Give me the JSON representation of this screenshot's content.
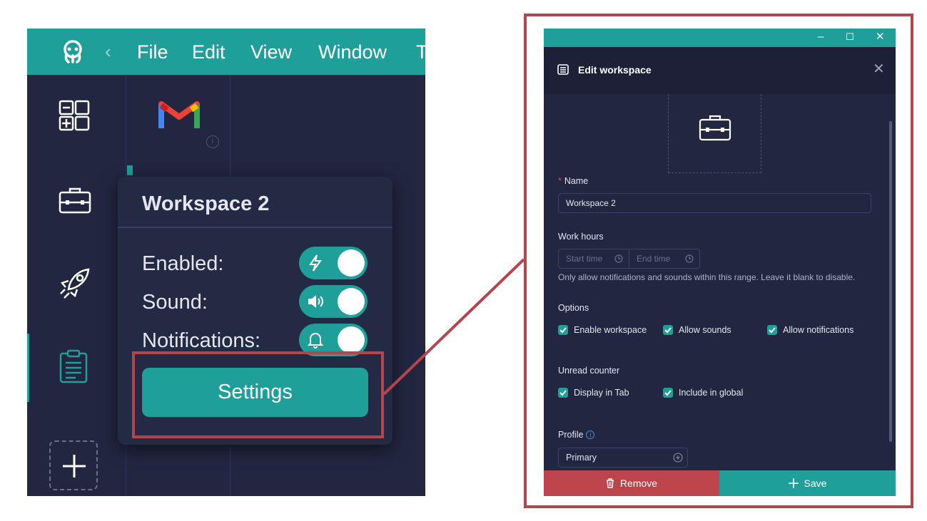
{
  "left_app": {
    "menu": {
      "items": [
        "File",
        "Edit",
        "View",
        "Window",
        "T"
      ],
      "back_glyph": "‹"
    },
    "sidebar_icons": [
      "apps-grid-icon",
      "briefcase-icon",
      "rocket-icon",
      "clipboard-icon",
      "add-icon"
    ],
    "service_icon": "gmail-icon",
    "popup": {
      "title": "Workspace 2",
      "enabled_label": "Enabled:",
      "sound_label": "Sound:",
      "notifications_label": "Notifications:",
      "enabled": true,
      "sound": true,
      "notifications": true,
      "settings_label": "Settings"
    }
  },
  "edit_window": {
    "title": "Edit workspace",
    "window_controls": [
      "–",
      "☐",
      "✕"
    ],
    "close_glyph": "✕",
    "name": {
      "label": "Name",
      "value": "Workspace 2"
    },
    "work_hours": {
      "label": "Work hours",
      "start_placeholder": "Start time",
      "end_placeholder": "End time",
      "hint": "Only allow notifications and sounds within this range. Leave it blank to disable."
    },
    "options": {
      "label": "Options",
      "enable_workspace": "Enable workspace",
      "allow_sounds": "Allow sounds",
      "allow_notifications": "Allow notifications"
    },
    "unread_counter": {
      "label": "Unread counter",
      "display_in_tab": "Display in Tab",
      "include_in_global": "Include in global"
    },
    "profile": {
      "label": "Profile",
      "info_glyph": "i",
      "value": "Primary"
    },
    "remove_label": "Remove",
    "save_label": "Save"
  },
  "colors": {
    "accent": "#1f9f9a",
    "background": "#222640",
    "danger": "#be444c",
    "highlight_border": "#b6444c"
  }
}
